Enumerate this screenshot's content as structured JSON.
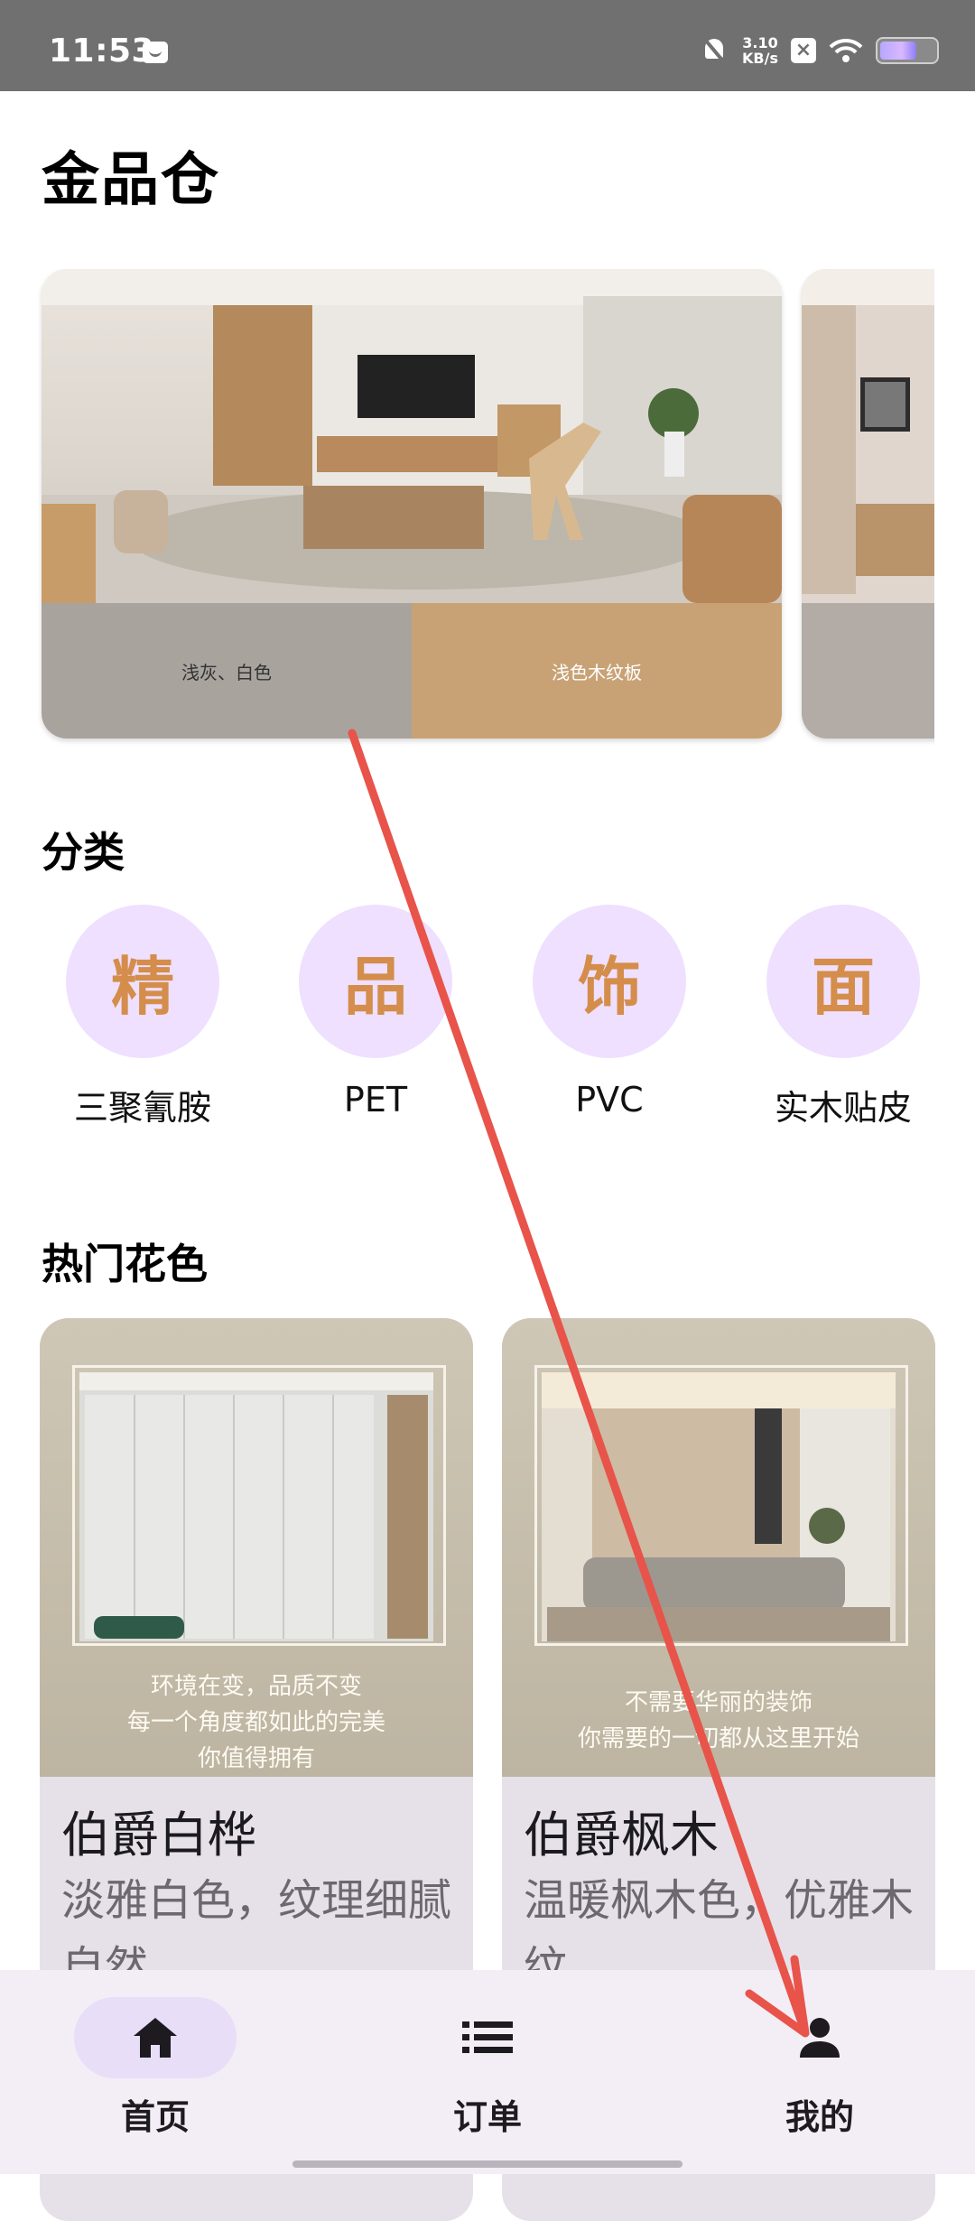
{
  "status_bar": {
    "time": "11:53",
    "net_speed_value": "3.10",
    "net_speed_unit": "KB/s"
  },
  "app": {
    "title": "金品仓"
  },
  "banners": [
    {
      "swatch_left": "浅灰、白色",
      "swatch_right": "浅色木纹板"
    },
    {
      "swatch_left": ""
    }
  ],
  "categories_section": {
    "title": "分类",
    "items": [
      {
        "glyph": "精",
        "label": "三聚氰胺"
      },
      {
        "glyph": "品",
        "label": "PET"
      },
      {
        "glyph": "饰",
        "label": "PVC"
      },
      {
        "glyph": "面",
        "label": "实木贴皮"
      }
    ]
  },
  "hot_section": {
    "title": "热门花色",
    "products": [
      {
        "photo_caption": [
          "环境在变，品质不变",
          "每一个角度都如此的完美",
          "你值得拥有"
        ],
        "name": "伯爵白桦",
        "description": "淡雅白色，纹理细腻自然"
      },
      {
        "photo_caption": [
          "不需要华丽的装饰",
          "你需要的一切都从这里开始"
        ],
        "name": "伯爵枫木",
        "description": "温暖枫木色，优雅木纹"
      }
    ]
  },
  "bottom_nav": {
    "items": [
      {
        "label": "首页",
        "icon": "home-icon",
        "active": true
      },
      {
        "label": "订单",
        "icon": "list-icon",
        "active": false
      },
      {
        "label": "我的",
        "icon": "person-icon",
        "active": false
      }
    ]
  },
  "colors": {
    "accent_glyph": "#d48d4b",
    "category_circle": "#eee0fe",
    "nav_active": "#e8def8",
    "swipe_arrow": "#e8534a"
  }
}
